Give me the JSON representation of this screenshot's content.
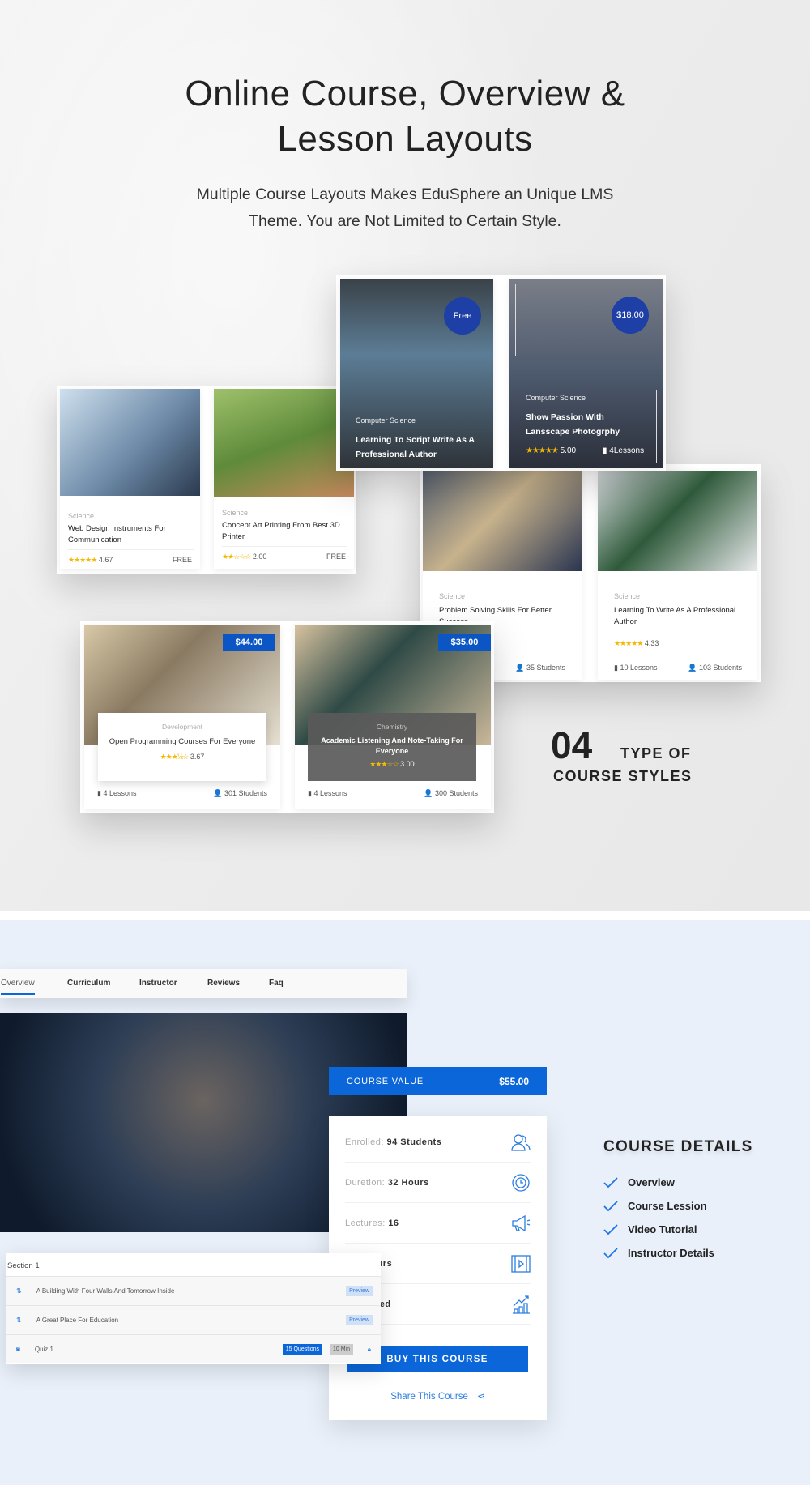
{
  "header": {
    "title_line1": "Online Course, Overview &",
    "title_line2": "Lesson Layouts",
    "subtitle_line1": "Multiple Course Layouts Makes EduSphere an Unique LMS",
    "subtitle_line2": "Theme. You are Not Limited to Certain Style."
  },
  "overlay_cards": [
    {
      "badge": "Free",
      "category": "Computer Science",
      "title": "Learning To Script Write As A Professional Author"
    },
    {
      "badge": "$18.00",
      "category": "Computer Science",
      "title": "Show Passion With Lansscape Photogrphy",
      "rating": "5.00",
      "lessons": "4Lessons"
    }
  ],
  "simple_cards": [
    {
      "category": "Science",
      "title": "Web Design Instruments For Communication",
      "rating": "4.67",
      "stars": 4.67,
      "price": "FREE"
    },
    {
      "category": "Science",
      "title": "Concept Art Printing From Best 3D Printer",
      "rating": "2.00",
      "stars": 2,
      "price": "FREE"
    }
  ],
  "list_cards": [
    {
      "category": "Science",
      "title": "Problem Solving Skills For Better Success",
      "students": "35 Students"
    },
    {
      "category": "Science",
      "title": "Learning To Write As A Professional Author",
      "rating": "4.33",
      "lessons": "10 Lessons",
      "students": "103 Students"
    }
  ],
  "boxed_cards": [
    {
      "price": "$44.00",
      "category": "Development",
      "title": "Open Programming Courses For Everyone",
      "rating": "3.67",
      "lessons": "4 Lessons",
      "students": "301 Students"
    },
    {
      "price": "$35.00",
      "category": "Chemistry",
      "title": "Academic Listening And Note-Taking For Everyone",
      "rating": "3.00",
      "lessons": "4 Lessons",
      "students": "300 Students"
    }
  ],
  "styles_count": {
    "number": "04",
    "line1": "TYPE OF",
    "line2": "COURSE STYLES"
  },
  "tabs": [
    "Overview",
    "Curriculum",
    "Instructor",
    "Reviews",
    "Faq"
  ],
  "course_value": {
    "label": "COURSE VALUE",
    "price": "$55.00"
  },
  "details": [
    {
      "key": "Enrolled:",
      "value": "94 Students",
      "icon": "users-icon"
    },
    {
      "key": "Duretion:",
      "value": "32 Hours",
      "icon": "timer-icon"
    },
    {
      "key": "Lectures:",
      "value": "16",
      "icon": "megaphone-icon"
    },
    {
      "key": "n:",
      "value": "2 Hours",
      "icon": "video-icon"
    },
    {
      "key": "",
      "value": "Advanced",
      "icon": "chart-icon"
    }
  ],
  "buy_label": "BUY THIS COURSE",
  "share_label": "Share This Course",
  "curriculum": {
    "section": "Section 1",
    "lessons": [
      {
        "title": "A Building With Four Walls And Tomorrow Inside",
        "tag": "Preview"
      },
      {
        "title": "A Great Place For Education",
        "tag": "Preview"
      }
    ],
    "quiz": {
      "title": "Quiz 1",
      "questions": "15 Questions",
      "duration": "10 Min"
    }
  },
  "course_details": {
    "title": "COURSE DETAILS",
    "items": [
      "Overview",
      "Course Lession",
      "Video Tutorial",
      "Instructor Details"
    ]
  },
  "colors": {
    "accent": "#0b66d9",
    "badge": "#1d3fa6",
    "star": "#f5b800",
    "bottom_bg": "#e9f0fa"
  }
}
